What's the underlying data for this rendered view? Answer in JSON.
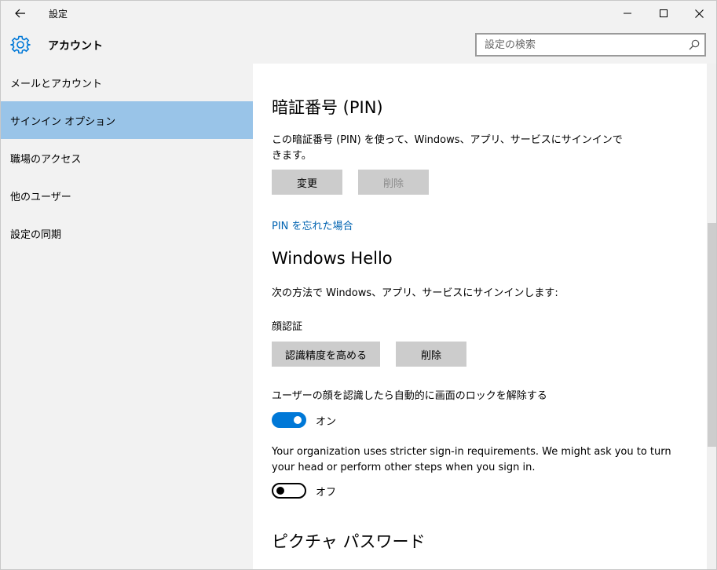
{
  "window": {
    "title": "設定"
  },
  "header": {
    "title": "アカウント",
    "search_placeholder": "設定の検索"
  },
  "sidebar": {
    "items": [
      {
        "label": "メールとアカウント"
      },
      {
        "label": "サインイン オプション",
        "active": true
      },
      {
        "label": "職場のアクセス"
      },
      {
        "label": "他のユーザー"
      },
      {
        "label": "設定の同期"
      }
    ]
  },
  "pin": {
    "heading": "暗証番号 (PIN)",
    "description": "この暗証番号 (PIN) を使って、Windows、アプリ、サービスにサインインできます。",
    "change_label": "変更",
    "remove_label": "削除",
    "forgot_link": "PIN を忘れた場合"
  },
  "hello": {
    "heading": "Windows Hello",
    "description": "次の方法で Windows、アプリ、サービスにサインインします:",
    "face_label": "顔認証",
    "improve_label": "認識精度を高める",
    "remove_label": "削除",
    "auto_unlock_text": "ユーザーの顔を認識したら自動的に画面のロックを解除する",
    "auto_unlock_state": "オン",
    "stricter_text": "Your organization uses stricter sign-in requirements. We might ask you to turn your head or perform other steps when you sign in.",
    "stricter_state": "オフ"
  },
  "picture_password": {
    "heading": "ピクチャ パスワード"
  },
  "colors": {
    "accent": "#0078d7",
    "selected": "#99c4e8",
    "link": "#0063b1"
  }
}
